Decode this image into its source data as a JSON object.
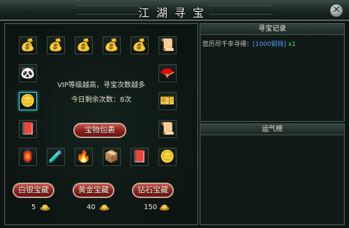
{
  "window": {
    "title": "江湖寻宝"
  },
  "left": {
    "row1_icons": [
      "money-bag-teal-icon",
      "money-bag-gold-icon",
      "money-bag-yellow-green-icon",
      "money-bag-green-icon",
      "money-bag-blue-icon",
      "scroll-orange-icon"
    ],
    "col_left_icons": [
      "panda-icon",
      "coin-icon",
      "red-book-icon"
    ],
    "col_right_icons": [
      "purple-fan-icon",
      "purple-scroll-icon",
      "orange-scroll-icon"
    ],
    "row_bottom_icons": [
      "lantern-icon",
      "purple-potion-icon",
      "fire-token-icon",
      "orange-crate-icon",
      "red-book-icon",
      "coin-stack-icon"
    ],
    "vip_text": "VIP等级越高，寻宝次数越多",
    "remaining_text": "今日剩余次数：8次",
    "treasure_bag_label": "宝物包裹",
    "buttons": [
      {
        "label": "白银宝藏",
        "cost": "5"
      },
      {
        "label": "黄金宝藏",
        "cost": "40"
      },
      {
        "label": "钻石宝藏",
        "cost": "150"
      }
    ]
  },
  "records": {
    "title": "寻宝记录",
    "entry_prefix": "您历尽千辛寻得：",
    "entry_item": "[1000铜钱]",
    "entry_qty": "x1"
  },
  "ranking": {
    "title": "运气榜"
  },
  "colors": {
    "accent_red": "#8d1f1c",
    "highlight_cyan": "#49d2e6",
    "item_blue": "#4f9cff",
    "qty_green": "#59e062"
  }
}
